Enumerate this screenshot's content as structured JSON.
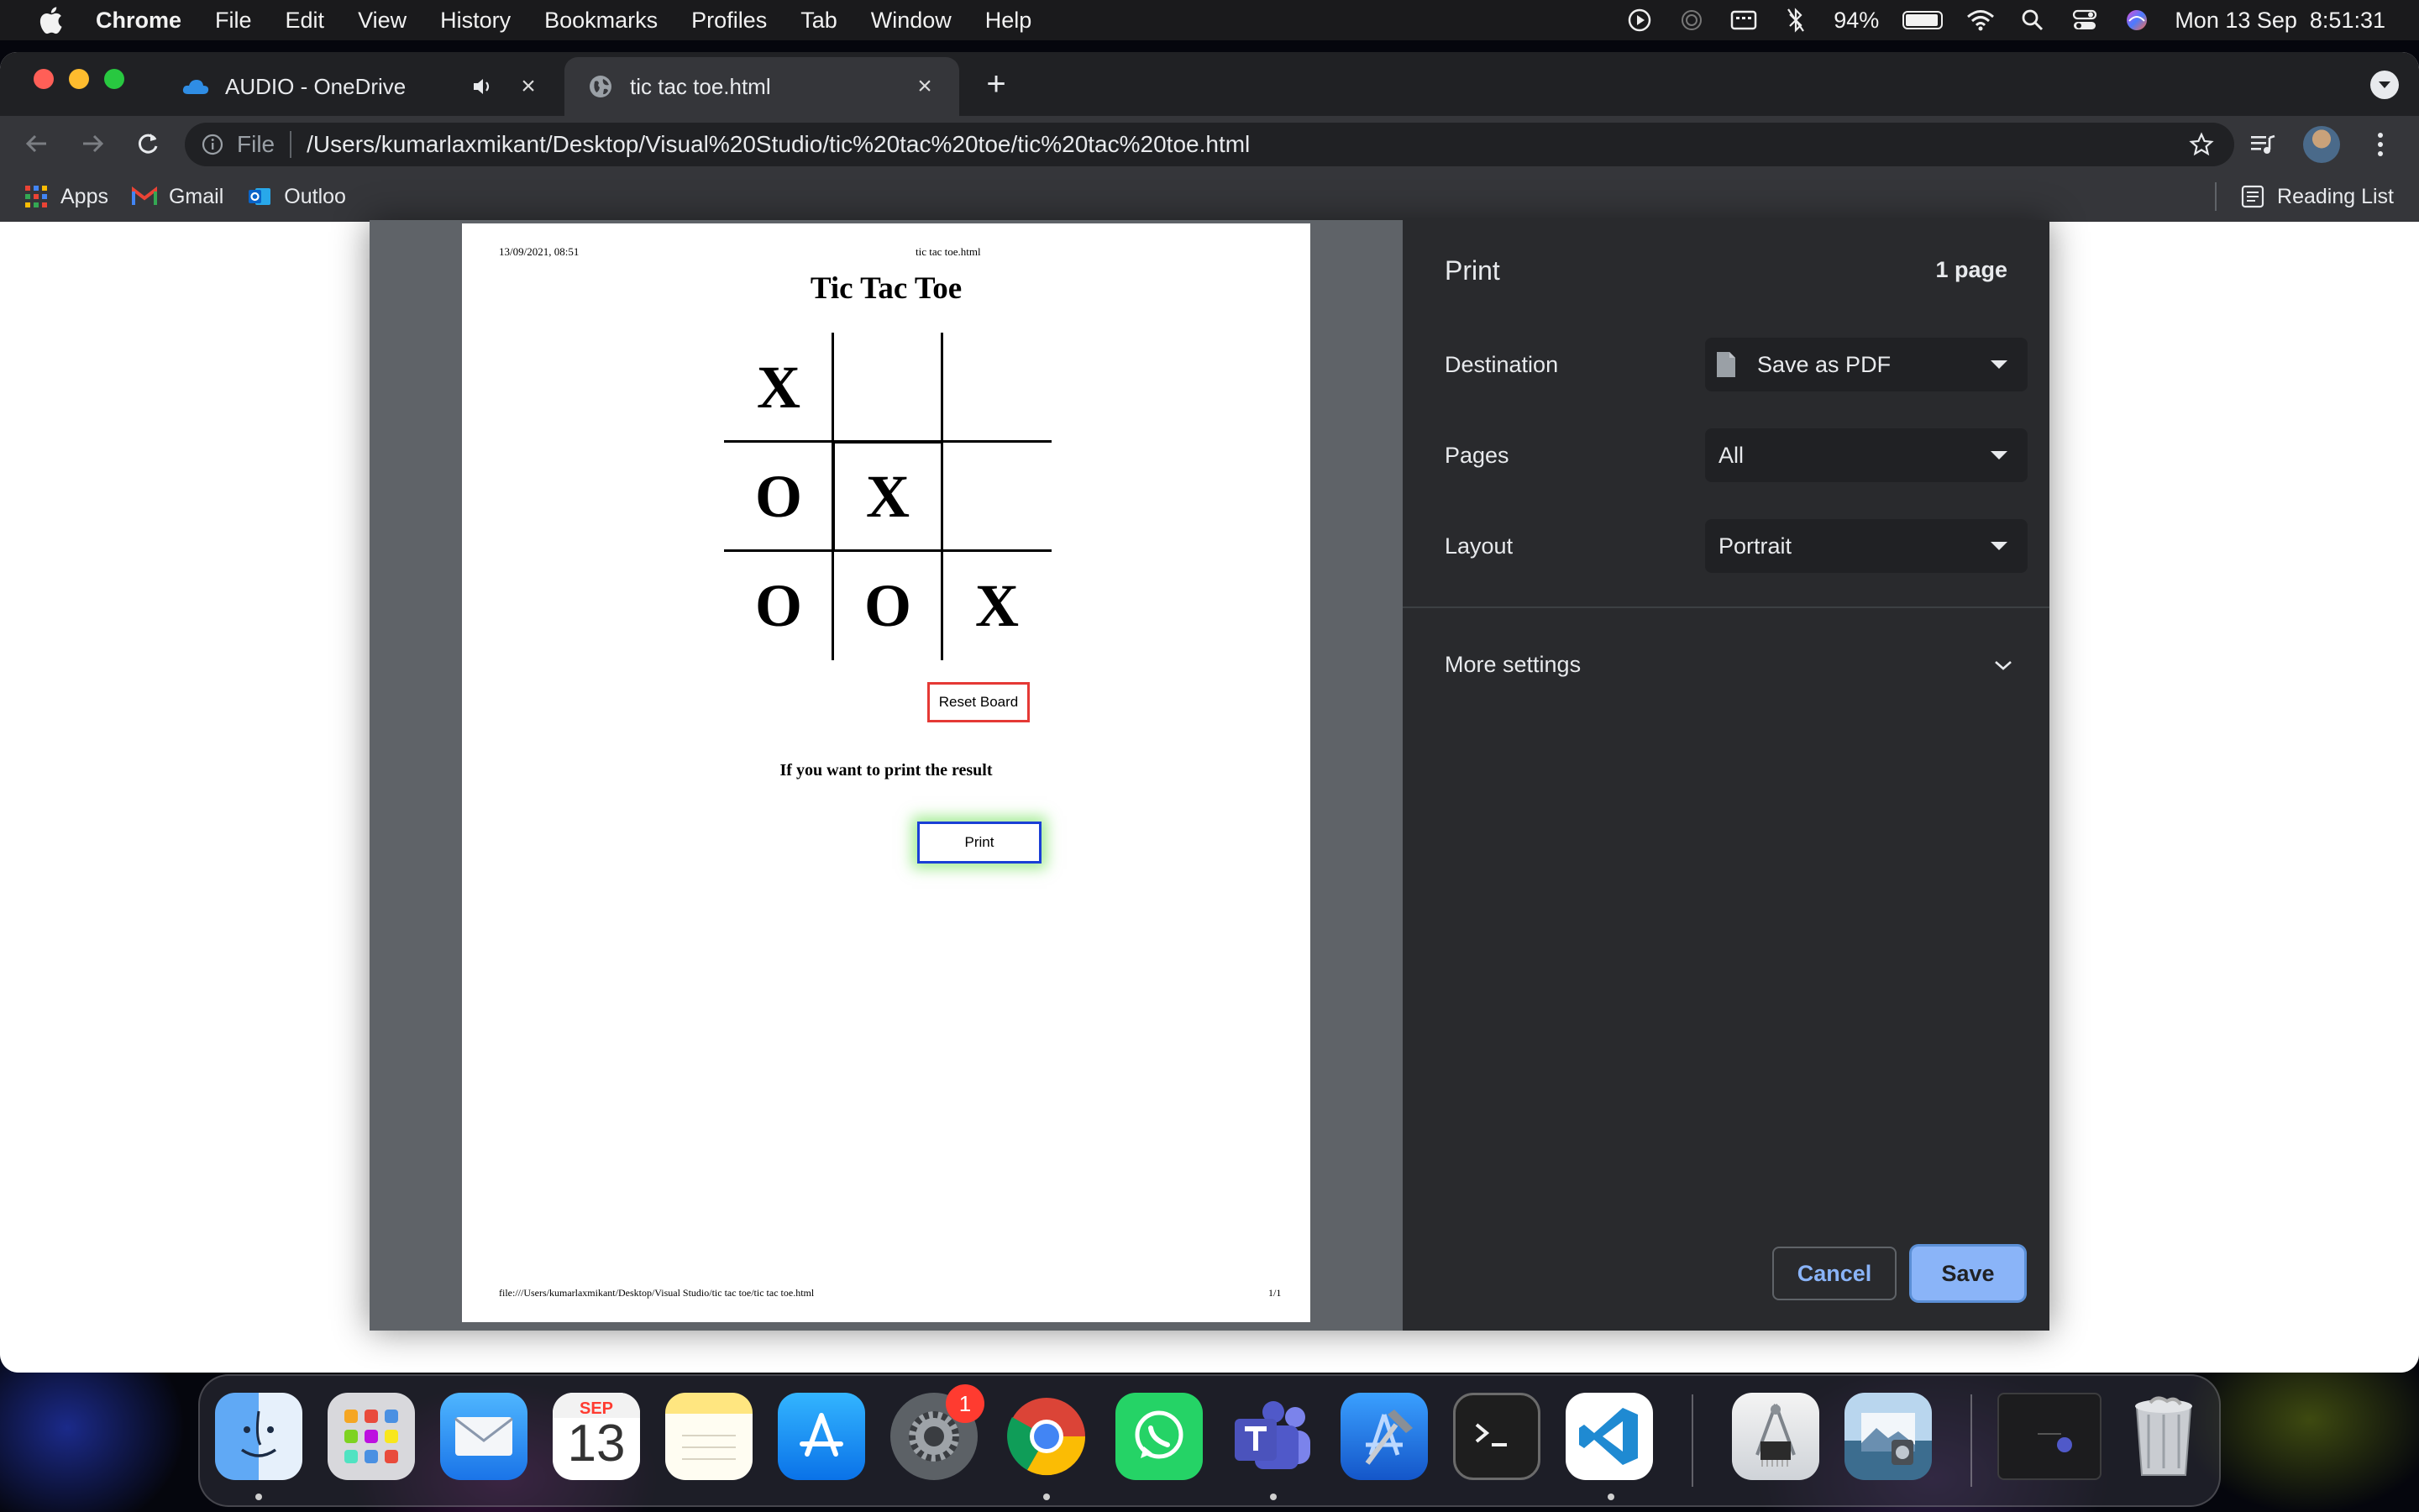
{
  "menubar": {
    "app_name": "Chrome",
    "items": [
      "File",
      "Edit",
      "View",
      "History",
      "Bookmarks",
      "Profiles",
      "Tab",
      "Window",
      "Help"
    ],
    "battery_percent": "94%",
    "battery_level": 0.94,
    "datetime": "Mon 13 Sep  8:51:31"
  },
  "browser": {
    "tabs": [
      {
        "title": "AUDIO - OneDrive",
        "icon": "onedrive-icon",
        "playing_audio": true
      },
      {
        "title": "tic tac toe.html",
        "icon": "globe-icon",
        "active": true
      }
    ],
    "omnibox": {
      "scheme": "File",
      "url": "/Users/kumarlaxmikant/Desktop/Visual%20Studio/tic%20tac%20toe/tic%20tac%20toe.html"
    },
    "bookmarks": [
      {
        "label": "Apps",
        "icon": "apps-grid-icon"
      },
      {
        "label": "Gmail",
        "icon": "gmail-icon"
      },
      {
        "label": "Outloo",
        "icon": "outlook-icon"
      }
    ],
    "reading_list": "Reading List"
  },
  "preview": {
    "header_date": "13/09/2021, 08:51",
    "header_title": "tic tac toe.html",
    "doc_title": "Tic Tac Toe",
    "board": [
      "X",
      "",
      "",
      "O",
      "X",
      "",
      "O",
      "O",
      "X"
    ],
    "reset_label": "Reset Board",
    "prompt": "If you want to print the result",
    "print_label": "Print",
    "footer_path": "file:///Users/kumarlaxmikant/Desktop/Visual Studio/tic tac toe/tic tac toe.html",
    "footer_page": "1/1"
  },
  "print_settings": {
    "title": "Print",
    "page_count": "1 page",
    "destination_label": "Destination",
    "destination_value": "Save as PDF",
    "pages_label": "Pages",
    "pages_value": "All",
    "layout_label": "Layout",
    "layout_value": "Portrait",
    "more_settings": "More settings",
    "cancel_label": "Cancel",
    "save_label": "Save"
  },
  "dock": {
    "calendar_month": "SEP",
    "calendar_day": "13",
    "settings_badge": "1",
    "apps": [
      "finder",
      "launchpad",
      "mail",
      "calendar",
      "notes",
      "app-store",
      "system-preferences",
      "chrome",
      "whatsapp",
      "teams",
      "xcode",
      "terminal",
      "vscode",
      "system-information",
      "preview",
      "trash"
    ]
  },
  "colors": {
    "reset_border": "#e53935",
    "print_border": "#1a3fd6",
    "save_button": "#8ab4f8",
    "panel_bg": "#292a2d"
  }
}
